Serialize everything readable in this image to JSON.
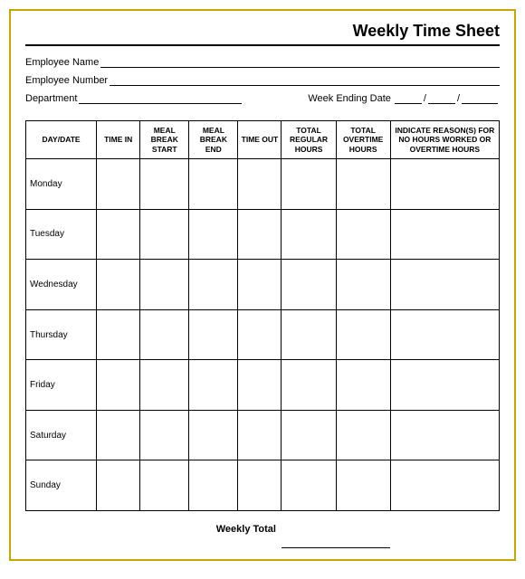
{
  "title": "Weekly Time Sheet",
  "form": {
    "employee_name_label": "Employee Name",
    "employee_number_label": "Employee Number",
    "department_label": "Department",
    "week_ending_label": "Week Ending Date"
  },
  "table": {
    "headers": [
      "DAY/DATE",
      "TIME IN",
      "MEAL BREAK START",
      "MEAL BREAK END",
      "TIME OUT",
      "TOTAL REGULAR HOURS",
      "TOTAL OVERTIME HOURS",
      "INDICATE REASON(S) FOR NO HOURS WORKED OR OVERTIME HOURS"
    ],
    "days": [
      "Monday",
      "Tuesday",
      "Wednesday",
      "Thursday",
      "Friday",
      "Saturday",
      "Sunday"
    ],
    "weekly_total_label": "Weekly Total"
  }
}
